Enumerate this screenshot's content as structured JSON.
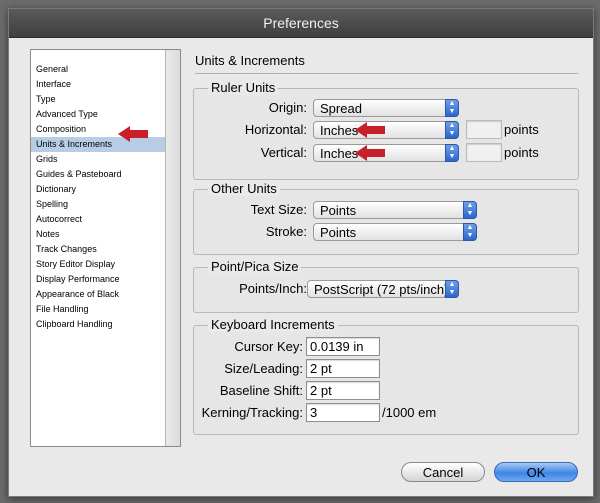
{
  "window": {
    "title": "Preferences"
  },
  "sidebar": {
    "items": [
      {
        "label": "General"
      },
      {
        "label": "Interface"
      },
      {
        "label": "Type"
      },
      {
        "label": "Advanced Type"
      },
      {
        "label": "Composition"
      },
      {
        "label": "Units & Increments",
        "selected": true
      },
      {
        "label": "Grids"
      },
      {
        "label": "Guides & Pasteboard"
      },
      {
        "label": "Dictionary"
      },
      {
        "label": "Spelling"
      },
      {
        "label": "Autocorrect"
      },
      {
        "label": "Notes"
      },
      {
        "label": "Track Changes"
      },
      {
        "label": "Story Editor Display"
      },
      {
        "label": "Display Performance"
      },
      {
        "label": "Appearance of Black"
      },
      {
        "label": "File Handling"
      },
      {
        "label": "Clipboard Handling"
      }
    ]
  },
  "panel": {
    "title": "Units & Increments"
  },
  "ruler_units": {
    "title": "Ruler Units",
    "origin_label": "Origin:",
    "origin_value": "Spread",
    "horizontal_label": "Horizontal:",
    "horizontal_value": "Inches",
    "horizontal_points_value": "",
    "horizontal_points_unit": "points",
    "vertical_label": "Vertical:",
    "vertical_value": "Inches",
    "vertical_points_value": "",
    "vertical_points_unit": "points"
  },
  "other_units": {
    "title": "Other Units",
    "text_size_label": "Text Size:",
    "text_size_value": "Points",
    "stroke_label": "Stroke:",
    "stroke_value": "Points"
  },
  "point_pica": {
    "title": "Point/Pica Size",
    "points_inch_label": "Points/Inch:",
    "points_inch_value": "PostScript (72 pts/inch)"
  },
  "keyboard": {
    "title": "Keyboard Increments",
    "cursor_key_label": "Cursor Key:",
    "cursor_key_value": "0.0139 in",
    "size_leading_label": "Size/Leading:",
    "size_leading_value": "2 pt",
    "baseline_shift_label": "Baseline Shift:",
    "baseline_shift_value": "2 pt",
    "kerning_label": "Kerning/Tracking:",
    "kerning_value": "3",
    "kerning_unit": "/1000 em"
  },
  "buttons": {
    "cancel": "Cancel",
    "ok": "OK"
  },
  "colors": {
    "accent": "#2b66cf",
    "selection": "#b7cde6",
    "annotation_arrow": "#c8202a"
  }
}
